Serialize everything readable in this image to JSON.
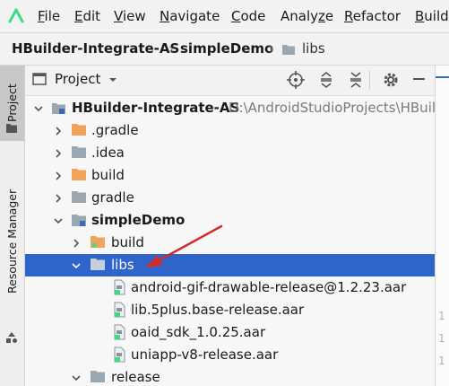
{
  "menu": {
    "items": [
      {
        "label": "File",
        "ul": "F",
        "rest": "ile"
      },
      {
        "label": "Edit",
        "ul": "E",
        "rest": "dit"
      },
      {
        "label": "View",
        "ul": "V",
        "rest": "iew"
      },
      {
        "label": "Navigate",
        "ul": "N",
        "rest": "avigate"
      },
      {
        "label": "Code",
        "ul": "C",
        "rest": "ode"
      },
      {
        "label": "Analyze",
        "ul": "z",
        "pre": "Analy",
        "rest": "e"
      },
      {
        "label": "Refactor",
        "ul": "R",
        "rest": "efactor"
      },
      {
        "label": "Build",
        "ul": "B",
        "rest": "uild"
      }
    ]
  },
  "breadcrumb": {
    "project": "HBuilder-Integrate-AS",
    "module": "simpleDemo",
    "folder": "libs"
  },
  "sidebar": {
    "project_tab": "Project",
    "resource_tab": "Resource Manager"
  },
  "panel": {
    "view_selector": "Project"
  },
  "tree": {
    "root_name": "HBuilder-Integrate-AS",
    "root_path": "D:\\AndroidStudioProjects\\HBuil",
    "gradle_hidden": ".gradle",
    "idea": ".idea",
    "build": "build",
    "gradle": "gradle",
    "module": "simpleDemo",
    "module_build": "build",
    "libs": "libs",
    "files": [
      "android-gif-drawable-release@1.2.23.aar",
      "lib.5plus.base-release.aar",
      "oaid_sdk_1.0.25.aar",
      "uniapp-v8-release.aar"
    ],
    "release": "release"
  },
  "editor": {
    "gutter": [
      "1",
      "1",
      "1"
    ]
  },
  "colors": {
    "selection": "#2f65ca",
    "orange_folder": "#f0a35a",
    "grey_folder": "#9aa7b1",
    "arrow": "#d22b2b"
  }
}
